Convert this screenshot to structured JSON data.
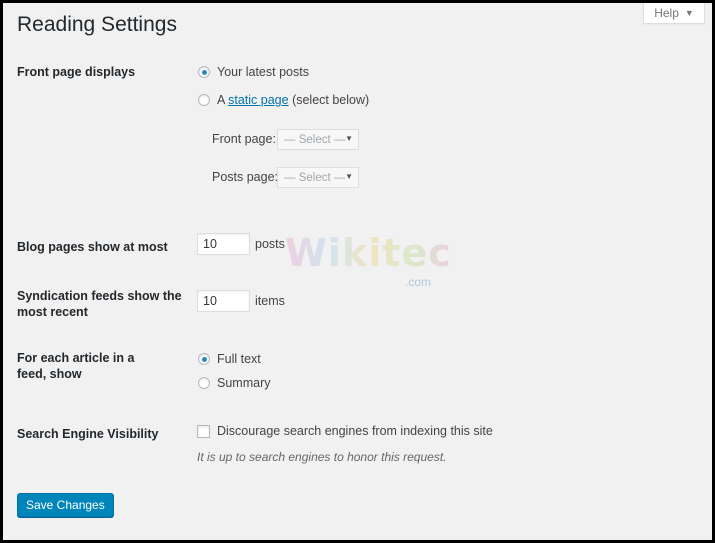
{
  "help": {
    "label": "Help"
  },
  "page": {
    "title": "Reading Settings"
  },
  "front_page": {
    "label": "Front page displays",
    "options": [
      {
        "label": "Your latest posts",
        "checked": true
      },
      {
        "prefix": "A ",
        "link": "static page",
        "suffix": " (select below)",
        "checked": false
      }
    ],
    "front_page_select": {
      "label": "Front page:",
      "value": "— Select —"
    },
    "posts_page_select": {
      "label": "Posts page:",
      "value": "— Select —"
    }
  },
  "blog_pages": {
    "label": "Blog pages show at most",
    "value": "10",
    "unit": "posts"
  },
  "syndication": {
    "label": "Syndication feeds show the most recent",
    "value": "10",
    "unit": "items"
  },
  "feed_article": {
    "label": "For each article in a feed, show",
    "options": [
      {
        "label": "Full text",
        "checked": true
      },
      {
        "label": "Summary",
        "checked": false
      }
    ]
  },
  "search_visibility": {
    "label": "Search Engine Visibility",
    "checkbox_label": "Discourage search engines from indexing this site",
    "checked": false,
    "description": "It is up to search engines to honor this request."
  },
  "save": {
    "label": "Save Changes"
  },
  "watermark": {
    "main": "Wikitechy",
    "sub": ".com"
  },
  "colors": {
    "accent": "#0085ba",
    "link": "#0073aa",
    "radio_dot": "#1e8cbe"
  }
}
